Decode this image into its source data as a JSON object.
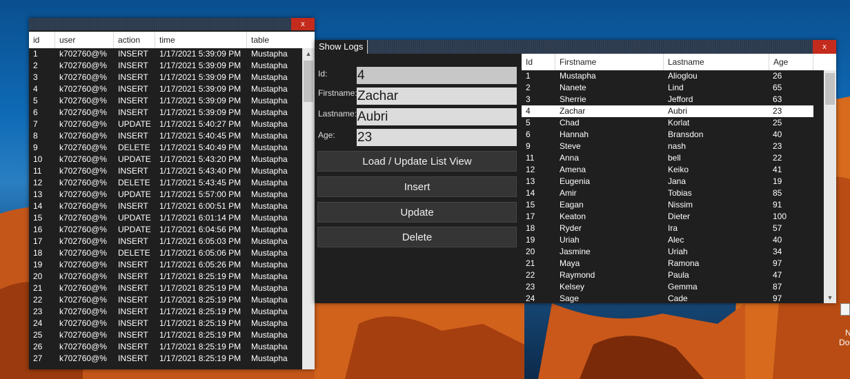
{
  "logs_window": {
    "close_label": "x",
    "columns": [
      "id",
      "user",
      "action",
      "time",
      "table"
    ],
    "rows": [
      [
        "1",
        "k702760@%",
        "INSERT",
        "1/17/2021 5:39:09 PM",
        "Mustapha"
      ],
      [
        "2",
        "k702760@%",
        "INSERT",
        "1/17/2021 5:39:09 PM",
        "Mustapha"
      ],
      [
        "3",
        "k702760@%",
        "INSERT",
        "1/17/2021 5:39:09 PM",
        "Mustapha"
      ],
      [
        "4",
        "k702760@%",
        "INSERT",
        "1/17/2021 5:39:09 PM",
        "Mustapha"
      ],
      [
        "5",
        "k702760@%",
        "INSERT",
        "1/17/2021 5:39:09 PM",
        "Mustapha"
      ],
      [
        "6",
        "k702760@%",
        "INSERT",
        "1/17/2021 5:39:09 PM",
        "Mustapha"
      ],
      [
        "7",
        "k702760@%",
        "UPDATE",
        "1/17/2021 5:40:27 PM",
        "Mustapha"
      ],
      [
        "8",
        "k702760@%",
        "INSERT",
        "1/17/2021 5:40:45 PM",
        "Mustapha"
      ],
      [
        "9",
        "k702760@%",
        "DELETE",
        "1/17/2021 5:40:49 PM",
        "Mustapha"
      ],
      [
        "10",
        "k702760@%",
        "UPDATE",
        "1/17/2021 5:43:20 PM",
        "Mustapha"
      ],
      [
        "11",
        "k702760@%",
        "INSERT",
        "1/17/2021 5:43:40 PM",
        "Mustapha"
      ],
      [
        "12",
        "k702760@%",
        "DELETE",
        "1/17/2021 5:43:45 PM",
        "Mustapha"
      ],
      [
        "13",
        "k702760@%",
        "UPDATE",
        "1/17/2021 5:57:00 PM",
        "Mustapha"
      ],
      [
        "14",
        "k702760@%",
        "INSERT",
        "1/17/2021 6:00:51 PM",
        "Mustapha"
      ],
      [
        "15",
        "k702760@%",
        "UPDATE",
        "1/17/2021 6:01:14 PM",
        "Mustapha"
      ],
      [
        "16",
        "k702760@%",
        "UPDATE",
        "1/17/2021 6:04:56 PM",
        "Mustapha"
      ],
      [
        "17",
        "k702760@%",
        "INSERT",
        "1/17/2021 6:05:03 PM",
        "Mustapha"
      ],
      [
        "18",
        "k702760@%",
        "DELETE",
        "1/17/2021 6:05:06 PM",
        "Mustapha"
      ],
      [
        "19",
        "k702760@%",
        "INSERT",
        "1/17/2021 6:05:26 PM",
        "Mustapha"
      ],
      [
        "20",
        "k702760@%",
        "INSERT",
        "1/17/2021 8:25:19 PM",
        "Mustapha"
      ],
      [
        "21",
        "k702760@%",
        "INSERT",
        "1/17/2021 8:25:19 PM",
        "Mustapha"
      ],
      [
        "22",
        "k702760@%",
        "INSERT",
        "1/17/2021 8:25:19 PM",
        "Mustapha"
      ],
      [
        "23",
        "k702760@%",
        "INSERT",
        "1/17/2021 8:25:19 PM",
        "Mustapha"
      ],
      [
        "24",
        "k702760@%",
        "INSERT",
        "1/17/2021 8:25:19 PM",
        "Mustapha"
      ],
      [
        "25",
        "k702760@%",
        "INSERT",
        "1/17/2021 8:25:19 PM",
        "Mustapha"
      ],
      [
        "26",
        "k702760@%",
        "INSERT",
        "1/17/2021 8:25:19 PM",
        "Mustapha"
      ],
      [
        "27",
        "k702760@%",
        "INSERT",
        "1/17/2021 8:25:19 PM",
        "Mustapha"
      ]
    ]
  },
  "main_window": {
    "tab_label": "Show Logs",
    "close_label": "x",
    "form": {
      "id_label": "Id:",
      "id_value": "4",
      "firstname_label": "Firstname:",
      "firstname_value": "Zachar",
      "lastname_label": "Lastname:",
      "lastname_value": "Aubri",
      "age_label": "Age:",
      "age_value": "23"
    },
    "buttons": {
      "load": "Load / Update List View",
      "insert": "Insert",
      "update": "Update",
      "delete": "Delete"
    },
    "columns": [
      "Id",
      "Firstname",
      "Lastname",
      "Age"
    ],
    "selected_id": "4",
    "rows": [
      [
        "1",
        "Mustapha",
        "Alioglou",
        "26"
      ],
      [
        "2",
        "Nanete",
        "Lind",
        "65"
      ],
      [
        "3",
        "Sherrie",
        "Jefford",
        "63"
      ],
      [
        "4",
        "Zachar",
        "Aubri",
        "23"
      ],
      [
        "5",
        "Chad",
        "Korlat",
        "25"
      ],
      [
        "6",
        "Hannah",
        "Bransdon",
        "40"
      ],
      [
        "9",
        "Steve",
        "nash",
        "23"
      ],
      [
        "11",
        "Anna",
        "bell",
        "22"
      ],
      [
        "12",
        "Amena",
        "Keiko",
        "41"
      ],
      [
        "13",
        "Eugenia",
        "Jana",
        "19"
      ],
      [
        "14",
        "Amir",
        "Tobias",
        "85"
      ],
      [
        "15",
        "Eagan",
        "Nissim",
        "91"
      ],
      [
        "17",
        "Keaton",
        "Dieter",
        "100"
      ],
      [
        "18",
        "Ryder",
        "Ira",
        "57"
      ],
      [
        "19",
        "Uriah",
        "Alec",
        "40"
      ],
      [
        "20",
        "Jasmine",
        "Uriah",
        "34"
      ],
      [
        "21",
        "Maya",
        "Ramona",
        "97"
      ],
      [
        "22",
        "Raymond",
        "Paula",
        "47"
      ],
      [
        "23",
        "Kelsey",
        "Gemma",
        "87"
      ],
      [
        "24",
        "Sage",
        "Cade",
        "97"
      ]
    ]
  },
  "desktop_icon": {
    "label_line1": "N",
    "label_line2": "Doc"
  }
}
